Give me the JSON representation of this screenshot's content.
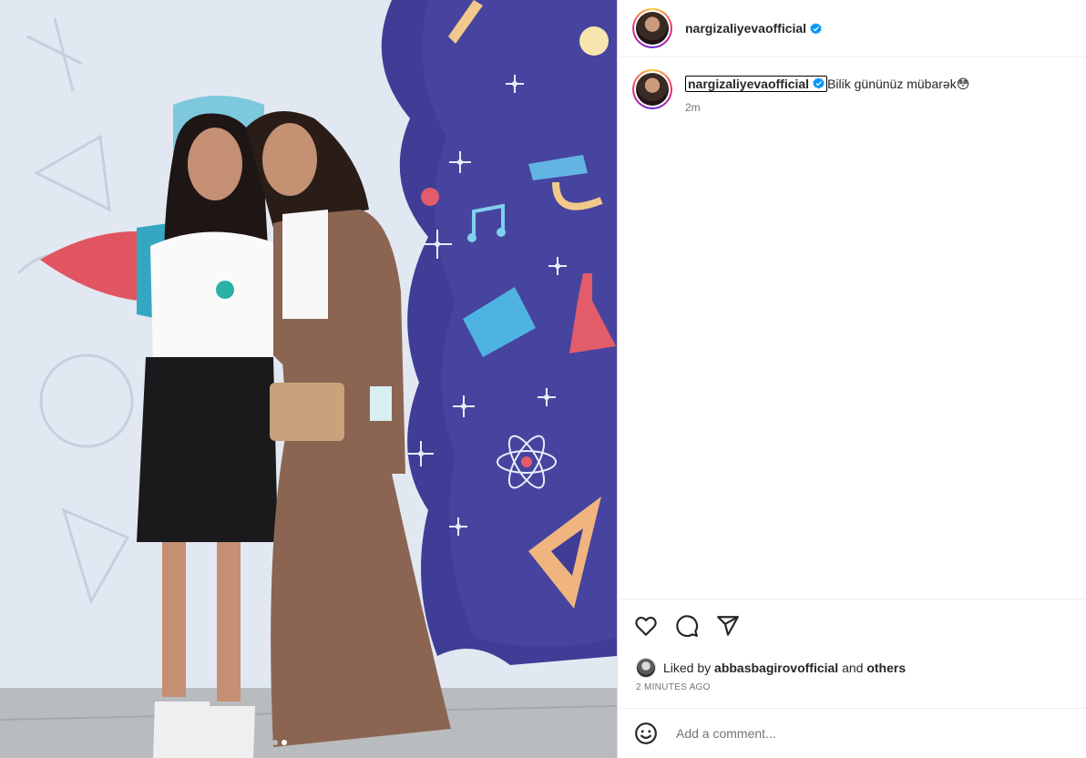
{
  "post": {
    "author": "nargizaliyevaofficial",
    "caption": "Bilik gününüz mübarək😳",
    "time_ago": "2m"
  },
  "likes": {
    "prefix": "Liked by",
    "user": "abbasbagirovofficial",
    "conjunction": "and",
    "others": "others"
  },
  "timestamp": "2 MINUTES AGO",
  "comment": {
    "placeholder": "Add a comment..."
  },
  "carousel": {
    "total": 2,
    "active": 2
  },
  "colors": {
    "verified": "#0095f6",
    "backdrop_blue": "#3f3d96",
    "suit_brown": "#8b6552"
  },
  "icons": [
    "verified-badge-icon",
    "heart-icon",
    "comment-icon",
    "share-icon",
    "emoji-icon"
  ]
}
